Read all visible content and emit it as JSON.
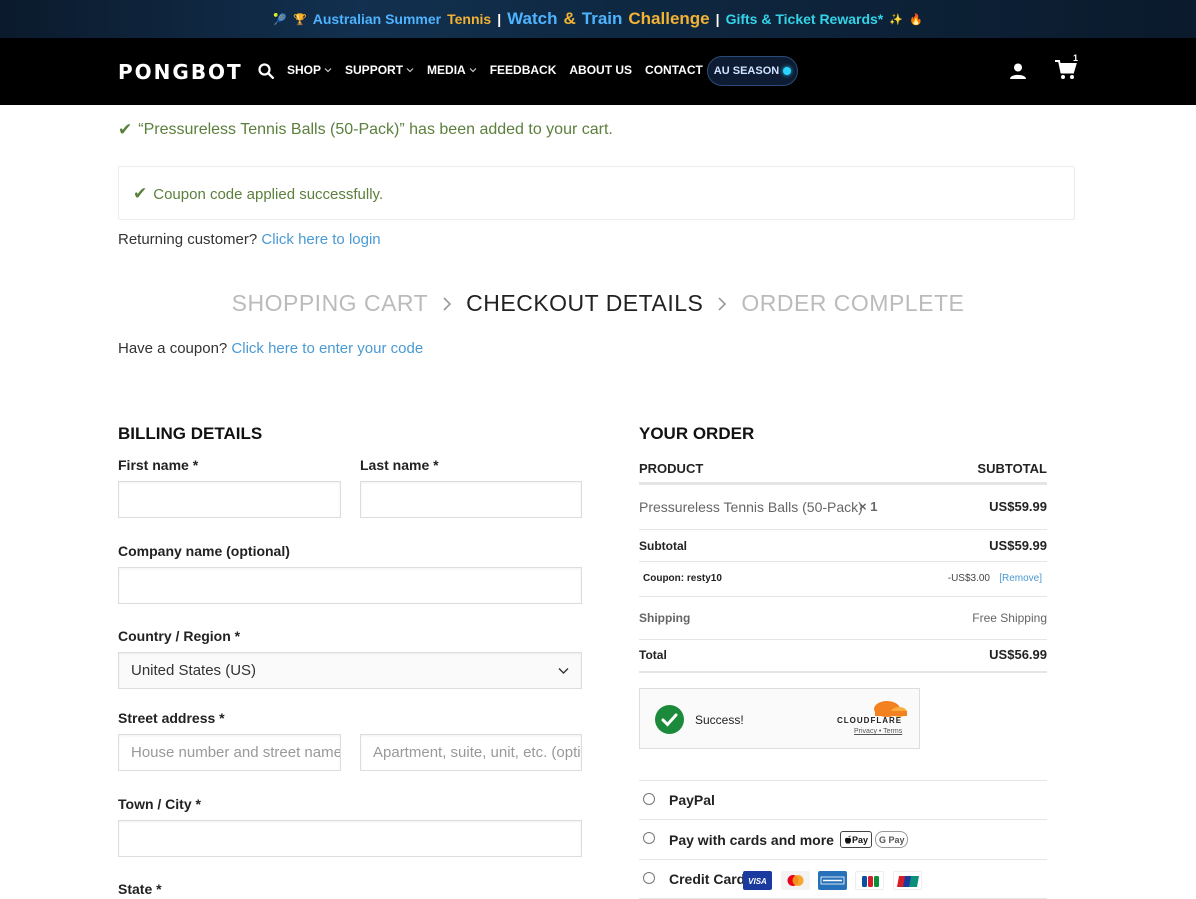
{
  "promo": {
    "p1": "Australian Summer",
    "p2": "Tennis",
    "sep1": "|",
    "p3": "Watch",
    "p4": "&",
    "p5": "Train",
    "p6": "Challenge",
    "sep2": "|",
    "p7": "Gifts & Ticket Rewards*"
  },
  "nav": {
    "logo": "PONGBOT",
    "items": [
      {
        "label": "SHOP"
      },
      {
        "label": "SUPPORT"
      },
      {
        "label": "MEDIA"
      },
      {
        "label": "FEEDBACK"
      },
      {
        "label": "ABOUT US"
      },
      {
        "label": "CONTACT"
      }
    ],
    "season_label": "AU SEASON",
    "cart_count": "1"
  },
  "notices": {
    "added": "“Pressureless Tennis Balls (50-Pack)” has been added to your cart.",
    "coupon_applied": "Coupon code applied successfully.",
    "returning_prefix": "Returning customer?",
    "returning_link": "Click here to login",
    "coupon_prefix": "Have a coupon?",
    "coupon_link": "Click here to enter your code"
  },
  "steps": {
    "cart": "SHOPPING CART",
    "checkout": "CHECKOUT DETAILS",
    "complete": "ORDER COMPLETE"
  },
  "billing": {
    "title": "BILLING DETAILS",
    "first_name_label": "First name *",
    "last_name_label": "Last name *",
    "company_label": "Company name (optional)",
    "country_label": "Country / Region *",
    "country_value": "United States (US)",
    "street_label": "Street address *",
    "street_placeholder": "House number and street name",
    "apt_placeholder": "Apartment, suite, unit, etc. (optional)",
    "city_label": "Town / City *",
    "state_label": "State *"
  },
  "order": {
    "title": "YOUR ORDER",
    "col_product": "PRODUCT",
    "col_subtotal": "SUBTOTAL",
    "item_name": "Pressureless Tennis Balls (50-Pack)",
    "item_qty": "× 1",
    "item_price": "US$59.99",
    "subtotal_label": "Subtotal",
    "subtotal_value": "US$59.99",
    "coupon_label": "Coupon: resty10",
    "coupon_value": "-US$3.00",
    "coupon_remove": "[Remove]",
    "shipping_label": "Shipping",
    "shipping_value": "Free Shipping",
    "total_label": "Total",
    "total_value": "US$56.99"
  },
  "turnstile": {
    "status": "Success!",
    "brand": "CLOUDFLARE",
    "links": "Privacy • Terms"
  },
  "payment": {
    "paypal": "PayPal",
    "cards": "Pay with cards and more",
    "apple_pay": "Pay",
    "google_pay": "G Pay",
    "credit": "Credit Card"
  },
  "colors": {
    "success_green": "#5b7f3c",
    "link_blue": "#4a9ad4",
    "nav_bg": "#000000"
  }
}
